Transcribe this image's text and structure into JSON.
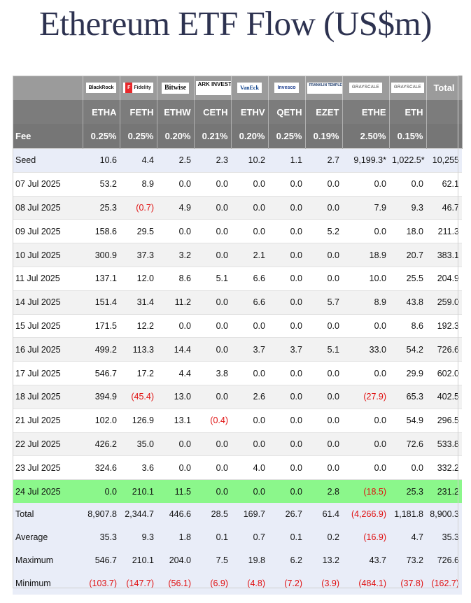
{
  "title": "Ethereum ETF Flow (US$m)",
  "issuers": [
    "BlackRock",
    "Fidelity",
    "Bitwise",
    "ARK INVEST",
    "VanEck",
    "Invesco",
    "FRANKLIN TEMPLETON",
    "GRAYSCALE",
    "GRAYSCALE"
  ],
  "total_label": "Total",
  "tickers": [
    "ETHA",
    "FETH",
    "ETHW",
    "CETH",
    "ETHV",
    "QETH",
    "EZET",
    "ETHE",
    "ETH"
  ],
  "fee_label": "Fee",
  "fees": [
    "0.25%",
    "0.25%",
    "0.20%",
    "0.21%",
    "0.20%",
    "0.25%",
    "0.19%",
    "2.50%",
    "0.15%"
  ],
  "rows": [
    {
      "label": "Seed",
      "values": [
        "10.6",
        "4.4",
        "2.5",
        "2.3",
        "10.2",
        "1.1",
        "2.7",
        "9,199.3*",
        "1,022.5*"
      ],
      "total": "10,255"
    },
    {
      "label": "07 Jul 2025",
      "values": [
        "53.2",
        "8.9",
        "0.0",
        "0.0",
        "0.0",
        "0.0",
        "0.0",
        "0.0",
        "0.0"
      ],
      "total": "62.1"
    },
    {
      "label": "08 Jul 2025",
      "values": [
        "25.3",
        "(0.7)",
        "4.9",
        "0.0",
        "0.0",
        "0.0",
        "0.0",
        "7.9",
        "9.3"
      ],
      "total": "46.7"
    },
    {
      "label": "09 Jul 2025",
      "values": [
        "158.6",
        "29.5",
        "0.0",
        "0.0",
        "0.0",
        "0.0",
        "5.2",
        "0.0",
        "18.0"
      ],
      "total": "211.3"
    },
    {
      "label": "10 Jul 2025",
      "values": [
        "300.9",
        "37.3",
        "3.2",
        "0.0",
        "2.1",
        "0.0",
        "0.0",
        "18.9",
        "20.7"
      ],
      "total": "383.1"
    },
    {
      "label": "11 Jul 2025",
      "values": [
        "137.1",
        "12.0",
        "8.6",
        "5.1",
        "6.6",
        "0.0",
        "0.0",
        "10.0",
        "25.5"
      ],
      "total": "204.9"
    },
    {
      "label": "14 Jul 2025",
      "values": [
        "151.4",
        "31.4",
        "11.2",
        "0.0",
        "6.6",
        "0.0",
        "5.7",
        "8.9",
        "43.8"
      ],
      "total": "259.0"
    },
    {
      "label": "15 Jul 2025",
      "values": [
        "171.5",
        "12.2",
        "0.0",
        "0.0",
        "0.0",
        "0.0",
        "0.0",
        "0.0",
        "8.6"
      ],
      "total": "192.3"
    },
    {
      "label": "16 Jul 2025",
      "values": [
        "499.2",
        "113.3",
        "14.4",
        "0.0",
        "3.7",
        "3.7",
        "5.1",
        "33.0",
        "54.2"
      ],
      "total": "726.6"
    },
    {
      "label": "17 Jul 2025",
      "values": [
        "546.7",
        "17.2",
        "4.4",
        "3.8",
        "0.0",
        "0.0",
        "0.0",
        "0.0",
        "29.9"
      ],
      "total": "602.0"
    },
    {
      "label": "18 Jul 2025",
      "values": [
        "394.9",
        "(45.4)",
        "13.0",
        "0.0",
        "2.6",
        "0.0",
        "0.0",
        "(27.9)",
        "65.3"
      ],
      "total": "402.5"
    },
    {
      "label": "21 Jul 2025",
      "values": [
        "102.0",
        "126.9",
        "13.1",
        "(0.4)",
        "0.0",
        "0.0",
        "0.0",
        "0.0",
        "54.9"
      ],
      "total": "296.5"
    },
    {
      "label": "22 Jul 2025",
      "values": [
        "426.2",
        "35.0",
        "0.0",
        "0.0",
        "0.0",
        "0.0",
        "0.0",
        "0.0",
        "72.6"
      ],
      "total": "533.8"
    },
    {
      "label": "23 Jul 2025",
      "values": [
        "324.6",
        "3.6",
        "0.0",
        "0.0",
        "4.0",
        "0.0",
        "0.0",
        "0.0",
        "0.0"
      ],
      "total": "332.2"
    },
    {
      "label": "24 Jul 2025",
      "values": [
        "0.0",
        "210.1",
        "11.5",
        "0.0",
        "0.0",
        "0.0",
        "2.8",
        "(18.5)",
        "25.3"
      ],
      "total": "231.2"
    },
    {
      "label": "Total",
      "values": [
        "8,907.8",
        "2,344.7",
        "446.6",
        "28.5",
        "169.7",
        "26.7",
        "61.4",
        "(4,266.9)",
        "1,181.8"
      ],
      "total": "8,900.3"
    },
    {
      "label": "Average",
      "values": [
        "35.3",
        "9.3",
        "1.8",
        "0.1",
        "0.7",
        "0.1",
        "0.2",
        "(16.9)",
        "4.7"
      ],
      "total": "35.3"
    },
    {
      "label": "Maximum",
      "values": [
        "546.7",
        "210.1",
        "204.0",
        "7.5",
        "19.8",
        "6.2",
        "13.2",
        "43.7",
        "73.2"
      ],
      "total": "726.6"
    },
    {
      "label": "Minimum",
      "values": [
        "(103.7)",
        "(147.7)",
        "(56.1)",
        "(6.9)",
        "(4.8)",
        "(7.2)",
        "(3.9)",
        "(484.1)",
        "(37.8)"
      ],
      "total": "(162.7)"
    }
  ],
  "colors": {
    "negative": "#e01010",
    "highlight_row": "#8bf78b",
    "header_bg": "#7c7c7c",
    "seed_summary_bg": "#e9edf8",
    "title": "#2d3250"
  }
}
